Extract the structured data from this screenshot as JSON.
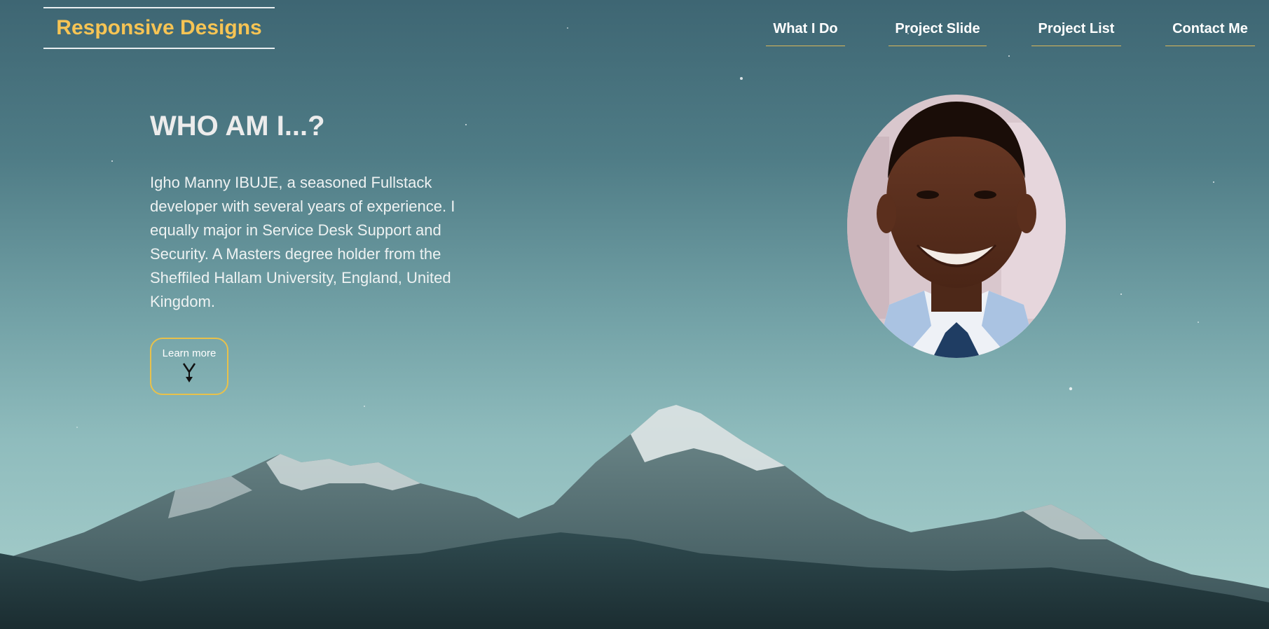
{
  "header": {
    "logo_text": "Responsive Designs",
    "nav": [
      {
        "label": "What I Do"
      },
      {
        "label": "Project Slide"
      },
      {
        "label": "Project List"
      },
      {
        "label": "Contact Me"
      }
    ]
  },
  "hero": {
    "title": "WHO AM I...?",
    "description": "Igho Manny IBUJE, a seasoned Fullstack developer with several years of experience. I equally major in Service Desk Support and Security. A Masters degree holder from the Sheffiled Hallam University, England, United Kingdom.",
    "learn_more_label": "Learn more",
    "learn_more_icon": "arrow-down-icon"
  },
  "colors": {
    "accent": "#f6c454",
    "button_border": "#e8c14b",
    "nav_underline": "#d8b75a"
  }
}
